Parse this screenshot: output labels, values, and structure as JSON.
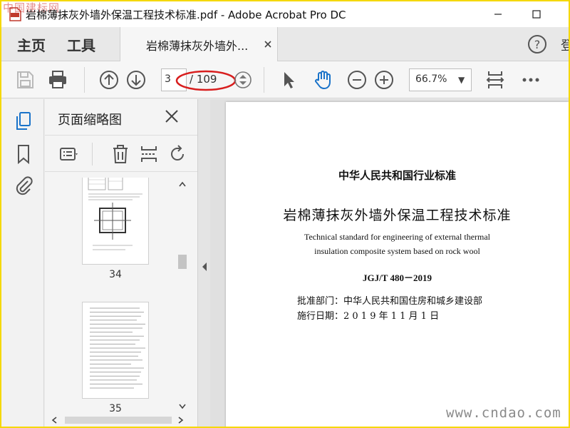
{
  "window": {
    "title": "岩棉薄抹灰外墙外保温工程技术标准.pdf - Adobe Acrobat Pro DC",
    "watermark_top": "中国建标网"
  },
  "tabs": {
    "home": "主页",
    "tools": "工具",
    "document_tab": "岩棉薄抹灰外墙外...",
    "signin_partial": "登"
  },
  "toolbar": {
    "current_page": "3",
    "page_total": "/ 109",
    "zoom": "66.7%"
  },
  "thumbnails_panel": {
    "title": "页面缩略图",
    "pages": [
      {
        "number": "34"
      },
      {
        "number": "35"
      }
    ]
  },
  "document": {
    "category": "中华人民共和国行业标准",
    "title": "岩棉薄抹灰外墙外保温工程技术标准",
    "english_line1": "Technical standard for engineering of external thermal",
    "english_line2": "insulation composite system based on rock wool",
    "code": "JGJ/T 480－2019",
    "approval": "批准部门：中华人民共和国住房和城乡建设部",
    "effective_date": "施行日期：2 0 1 9 年 1 1 月 1 日"
  },
  "watermark_bottom": "www.cndao.com",
  "colors": {
    "frame_border": "#f5d800",
    "annotation_ellipse": "#d81e1e",
    "icon_blue": "#1a73c9"
  }
}
